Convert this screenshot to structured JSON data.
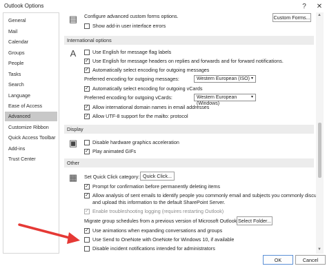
{
  "window": {
    "title": "Outlook Options",
    "help_glyph": "?",
    "close_glyph": "✕"
  },
  "sidebar": {
    "items": [
      {
        "label": "General"
      },
      {
        "label": "Mail"
      },
      {
        "label": "Calendar"
      },
      {
        "label": "Groups"
      },
      {
        "label": "People"
      },
      {
        "label": "Tasks"
      },
      {
        "label": "Search"
      },
      {
        "label": "Language"
      },
      {
        "label": "Ease of Access"
      },
      {
        "label": "Advanced",
        "active": true
      },
      {
        "label": "Customize Ribbon"
      },
      {
        "label": "Quick Access Toolbar"
      },
      {
        "label": "Add-ins"
      },
      {
        "label": "Trust Center"
      }
    ]
  },
  "top": {
    "custom_forms_text": "Configure advanced custom forms options.",
    "custom_forms_button": "Custom Forms...",
    "addin_errors": "Show add-in user interface errors"
  },
  "international": {
    "header": "International options",
    "english_flag": "Use English for message flag labels",
    "english_headers": "Use English for message headers on replies and forwards and for forward notifications.",
    "auto_encoding": "Automatically select encoding for outgoing messages",
    "preferred_label": "Preferred encoding for outgoing messages:",
    "preferred_value": "Western European (ISO)",
    "auto_vcards": "Automatically select encoding for outgoing vCards",
    "vcard_label": "Preferred encoding for outgoing vCards:",
    "vcard_value": "Western European (Windows)",
    "intl_domain": "Allow international domain names in email addresses",
    "utf8": "Allow UTF-8 support for the mailto: protocol"
  },
  "display": {
    "header": "Display",
    "hw_accel": "Disable hardware graphics acceleration",
    "gifs": "Play animated GIFs"
  },
  "other": {
    "header": "Other",
    "quick_click_label": "Set Quick Click category:",
    "quick_click_button": "Quick Click...",
    "prompt_delete": "Prompt for confirmation before permanently deleting items",
    "analysis_line1": "Allow analysis of sent emails to identify people you commonly email and subjects you commonly discuss,",
    "analysis_line2": "and upload this information to the default SharePoint Server.",
    "troubleshoot": "Enable troubleshooting logging (requires restarting Outlook)",
    "migrate_label": "Migrate group schedules from a previous version of Microsoft Outlook:",
    "select_folder_button": "Select Folder...",
    "animations": "Use animations when expanding conversations and groups",
    "onenote": "Use Send to OneNote with OneNote for Windows 10, if available",
    "incident": "Disable incident notifications intended for administrators"
  },
  "footer": {
    "ok": "OK",
    "cancel": "Cancel"
  },
  "colors": {
    "annotation_arrow": "#e53935",
    "active_nav": "#c8c8c8",
    "section_bg": "#ececec"
  },
  "icons": {
    "check": "✓",
    "dropdown": "▾",
    "scroll_up": "▲",
    "scroll_down": "▼"
  }
}
